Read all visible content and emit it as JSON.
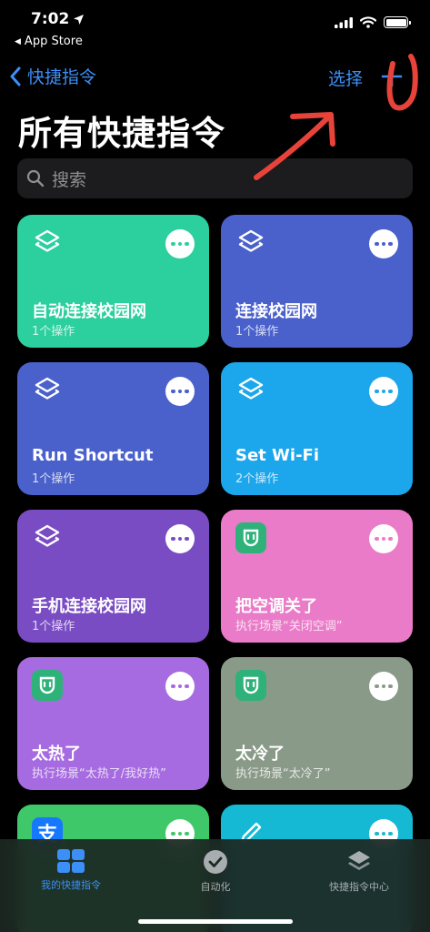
{
  "status_bar": {
    "time": "7:02",
    "back_app": "App Store"
  },
  "nav": {
    "back_label": "快捷指令",
    "select_label": "选择"
  },
  "page_title": "所有快捷指令",
  "search": {
    "placeholder": "搜索"
  },
  "shortcuts": [
    {
      "title": "自动连接校园网",
      "subtitle": "1个操作",
      "icon": "layers-icon",
      "color": "#2ccf9e"
    },
    {
      "title": "连接校园网",
      "subtitle": "1个操作",
      "icon": "layers-icon",
      "color": "#4a61cc"
    },
    {
      "title": "Run Shortcut",
      "subtitle": "1个操作",
      "icon": "layers-icon",
      "color": "#4a61cc"
    },
    {
      "title": "Set Wi-Fi",
      "subtitle": "2个操作",
      "icon": "layers-icon",
      "color": "#1ca6ec"
    },
    {
      "title": "手机连接校园网",
      "subtitle": "1个操作",
      "icon": "layers-icon",
      "color": "#7a4cc4"
    },
    {
      "title": "把空调关了",
      "subtitle": "执行场景“关闭空调”",
      "icon": "mi-home-icon",
      "color": "#ea7bc8"
    },
    {
      "title": "太热了",
      "subtitle": "执行场景“太热了/我好热”",
      "icon": "mi-home-icon",
      "color": "#a66be0"
    },
    {
      "title": "太冷了",
      "subtitle": "执行场景“太冷了”",
      "icon": "mi-home-icon",
      "color": "#8a9a88"
    },
    {
      "title": "",
      "subtitle": "",
      "icon": "alipay-icon",
      "color": "#3fc86a"
    },
    {
      "title": "",
      "subtitle": "",
      "icon": "pencil-icon",
      "color": "#15b9d4"
    }
  ],
  "tabs": [
    {
      "label": "我的快捷指令",
      "icon": "grid-icon",
      "active": true
    },
    {
      "label": "自动化",
      "icon": "clock-check-icon",
      "active": false
    },
    {
      "label": "快捷指令中心",
      "icon": "layers-icon",
      "active": false
    }
  ],
  "colors": {
    "accent": "#3b8ff6",
    "annotation": "#e8433a"
  }
}
